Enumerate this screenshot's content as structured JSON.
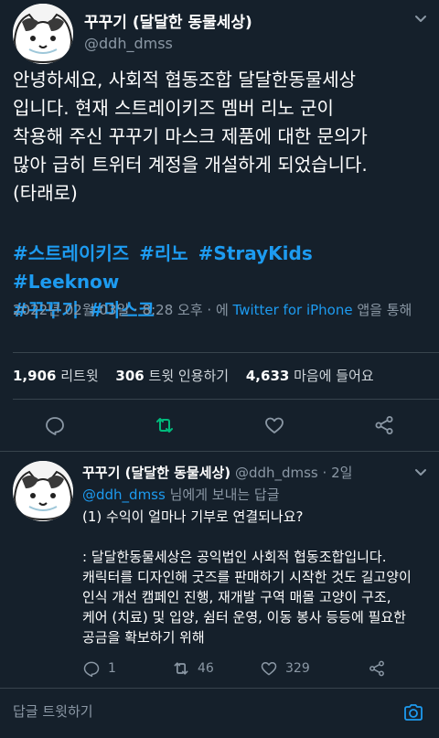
{
  "main_tweet": {
    "display_name": "꾸꾸기 (달달한 동물세상)",
    "handle": "@ddh_dmss",
    "body_lines": [
      "안녕하세요, 사회적 협동조합 달달한동물세상",
      "입니다. 현재 스트레이키즈 멤버 리노 군이",
      "착용해 주신 꾸꾸기 마스크 제품에 대한 문의가",
      "많아  급히 트위터 계정을 개설하게 되었습니다.",
      "(타래로)"
    ],
    "hashtags_line1": [
      "#스트레이키즈",
      "#리노",
      "#StrayKids",
      "#Leeknow"
    ],
    "hashtags_line2": [
      "#꾸꾸기",
      "#마스크"
    ],
    "timestamp": "2022년 02월 03일 · 8:28 오후 · 에 ",
    "client": "Twitter for iPhone",
    "client_suffix": " 앱을 통해",
    "retweets_count": "1,906",
    "retweets_label": "리트윗",
    "quotes_count": "306",
    "quotes_label": "트윗 인용하기",
    "likes_count": "4,633",
    "likes_label": "마음에 들어요"
  },
  "reply_tweet": {
    "display_name": "꾸꾸기 (달달한 동물세상)",
    "handle": "@ddh_dmss",
    "time": " · 2일",
    "replying_to_handle": "@ddh_dmss",
    "replying_to_suffix": " 님에게 보내는 답글",
    "body_lines": [
      "(1) 수익이 얼마나 기부로 연결되나요?",
      "",
      ": 달달한동물세상은 공익법인 사회적 협동조합입니다.",
      "캐릭터를 디자인해 굿즈를 판매하기 시작한 것도 길고양이",
      "인식 개선 캠페인 진행, 재개발 구역 매몰 고양이 구조,",
      "케어 (치료) 및 입양, 쉼터 운영, 이동 봉사 등등에 필요한",
      "공금을 확보하기 위해"
    ],
    "replies_count": "1",
    "retweets_count": "46",
    "likes_count": "329"
  },
  "bottom_bar": {
    "reply_placeholder": "답글 트윗하기"
  },
  "colors": {
    "background": "#15202b",
    "accent": "#1d9bf0",
    "retweet_green": "#00ba7c",
    "muted": "#8b98a5",
    "divider": "#38444d"
  },
  "icons": [
    "chevron-down-icon",
    "reply-icon",
    "retweet-icon",
    "like-icon",
    "share-icon",
    "camera-icon"
  ]
}
